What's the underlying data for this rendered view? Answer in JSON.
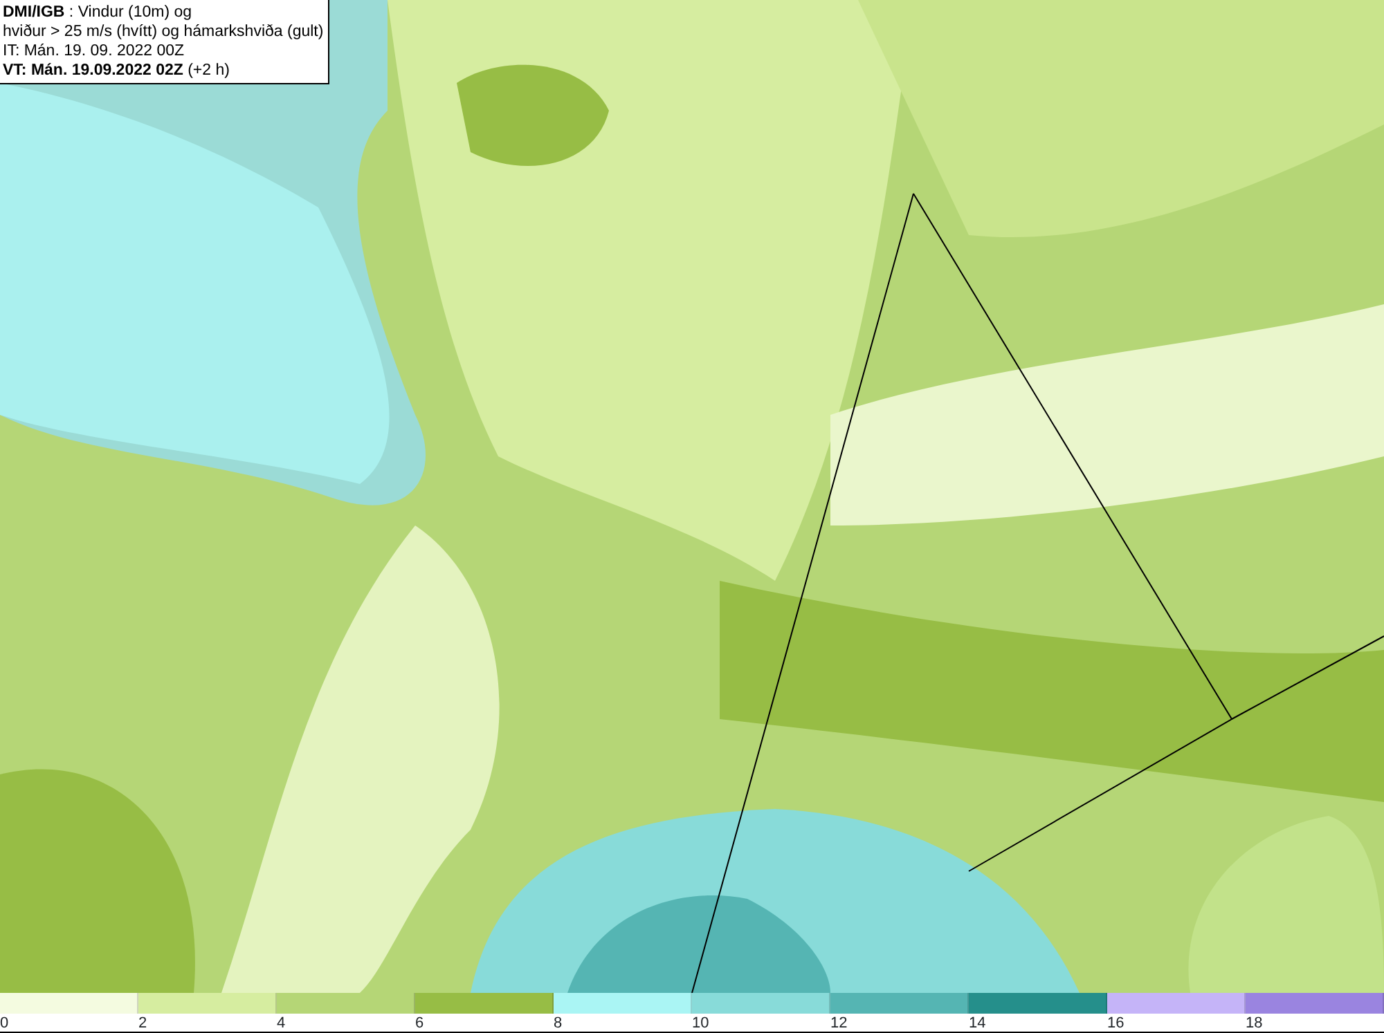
{
  "header": [
    "**DMI/IGB** : Vindur (10m) og",
    "hviður > 25 m/s (hvítt) og hámarkshviða (gult)",
    "IT: Mán. 19. 09. 2022 00Z",
    "**VT: Mán. 19.09.2022 02Z** (+2 h)"
  ],
  "legend": [
    {
      "color": "#f4fbe0",
      "label": "0"
    },
    {
      "color": "#d6eda0",
      "label": "2"
    },
    {
      "color": "#b5d676",
      "label": "4"
    },
    {
      "color": "#97bd45",
      "label": "6"
    },
    {
      "color": "#aaf5f4",
      "label": "8"
    },
    {
      "color": "#88dbd9",
      "label": "10"
    },
    {
      "color": "#55b5b3",
      "label": "12"
    },
    {
      "color": "#258f8b",
      "label": "14"
    },
    {
      "color": "#c5b4f8",
      "label": "16"
    },
    {
      "color": "#9a84e0",
      "label": "18"
    }
  ]
}
